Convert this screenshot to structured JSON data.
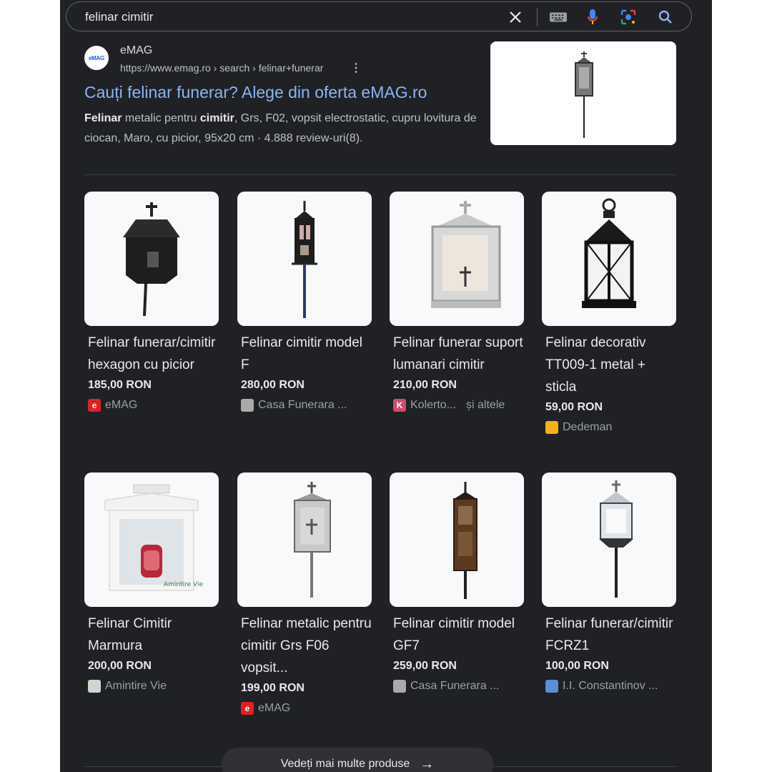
{
  "search": {
    "query": "felinar cimitir",
    "icons": [
      "close-icon",
      "keyboard-icon",
      "microphone-icon",
      "lens-icon",
      "search-icon"
    ]
  },
  "result": {
    "favicon_text": "eMAG",
    "site_name": "eMAG",
    "url": "https://www.emag.ro › search › felinar+funerar",
    "title": "Cauți felinar funerar? Alege din oferta eMAG.ro",
    "snippet_bold1": "Felinar",
    "snippet_text1": " metalic pentru ",
    "snippet_bold2": "cimitir",
    "snippet_text2": ", Grs, F02, vopsit electrostatic, cupru lovitura de ciocan, Maro, cu picior, 95x20 cm · 4.888 review-uri(8)."
  },
  "products": [
    {
      "name": "Felinar funerar/cimitir hexagon cu picior",
      "price": "185,00 RON",
      "seller": "eMAG",
      "extra": "",
      "fav": "e",
      "fav_color": "#e31f26",
      "img": "hex"
    },
    {
      "name": "Felinar cimitir model F",
      "price": "280,00 RON",
      "seller": "Casa Funerara ...",
      "extra": "",
      "fav": "",
      "fav_color": "#aaaaaa",
      "img": "slim"
    },
    {
      "name": "Felinar funerar suport lumanari cimitir",
      "price": "210,00 RON",
      "seller": "Kolerto...",
      "extra": "și altele",
      "fav": "K",
      "fav_color": "#d14b6f",
      "img": "silver"
    },
    {
      "name": "Felinar decorativ TT009-1 metal + sticla",
      "price": "59,00 RON",
      "seller": "Dedeman",
      "extra": "",
      "fav": "",
      "fav_color": "#f3b21b",
      "img": "lantern"
    },
    {
      "name": "Felinar Cimitir Marmura",
      "price": "200,00 RON",
      "seller": "Amintire Vie",
      "extra": "",
      "fav": "",
      "fav_color": "#cfd8cf",
      "img": "marble"
    },
    {
      "name": "Felinar metalic pentru cimitir Grs F06 vopsit...",
      "price": "199,00 RON",
      "seller": "eMAG",
      "extra": "",
      "fav": "e",
      "fav_color": "#e31f26",
      "img": "grey"
    },
    {
      "name": "Felinar cimitir model GF7",
      "price": "259,00 RON",
      "seller": "Casa Funerara ...",
      "extra": "",
      "fav": "",
      "fav_color": "#aaaaaa",
      "img": "copper"
    },
    {
      "name": "Felinar funerar/cimitir FCRZ1",
      "price": "100,00 RON",
      "seller": "I.I. Constantinov ...",
      "extra": "",
      "fav": "",
      "fav_color": "#5b8fd6",
      "img": "chrome"
    }
  ],
  "more_button": "Vedeți mai multe produse",
  "thumb_image": "lantern-on-post",
  "marble_brand": "Amintire Vie"
}
